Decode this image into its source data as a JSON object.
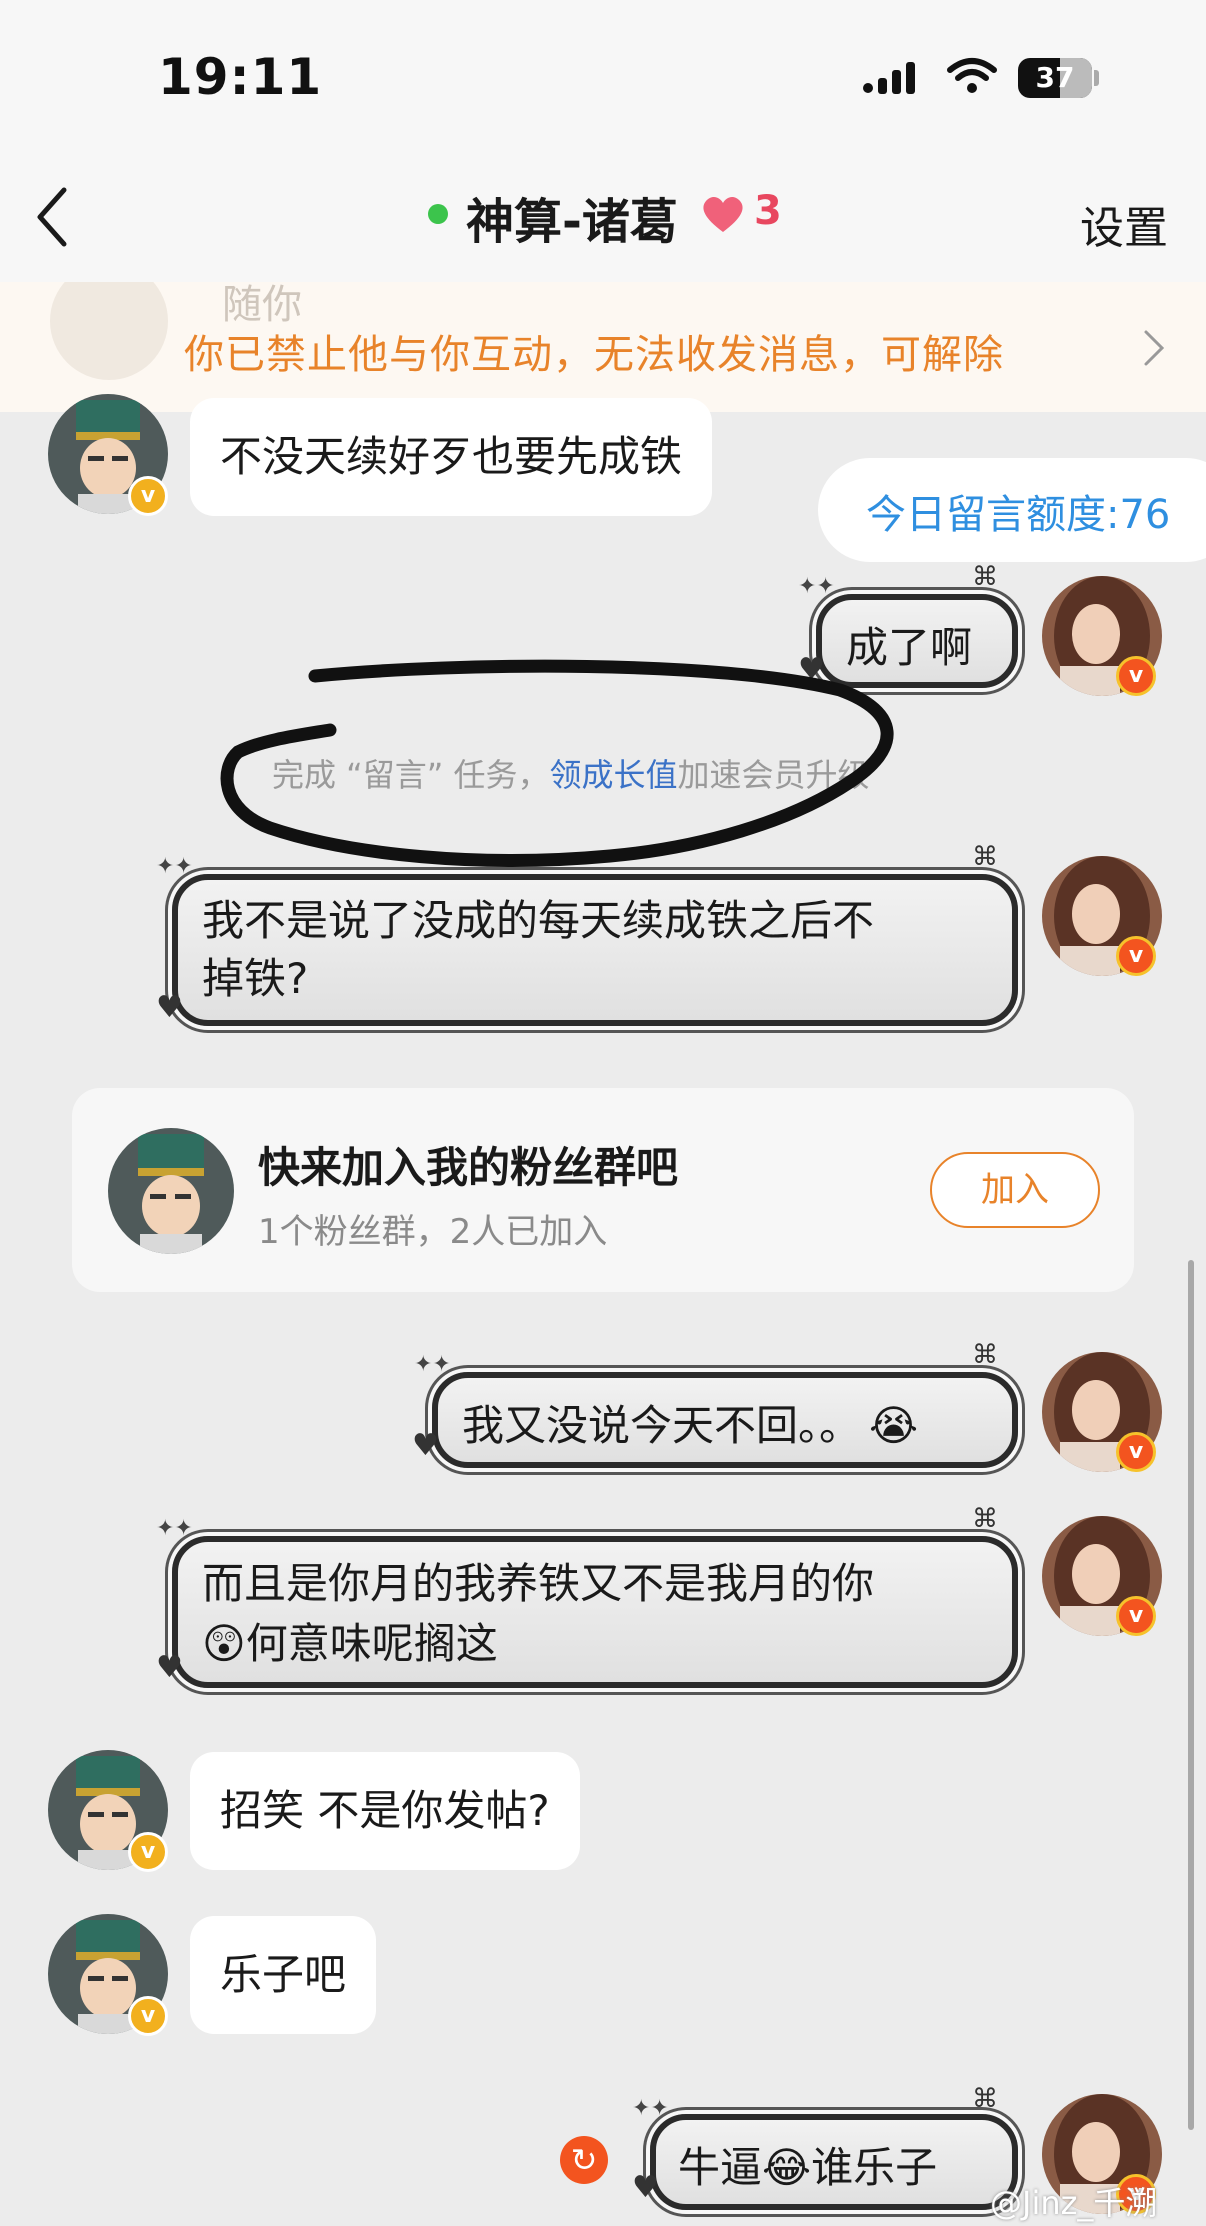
{
  "status_bar": {
    "time": "19:11",
    "battery": "37"
  },
  "nav": {
    "title": "神算-诸葛",
    "heart_count": "3",
    "settings_label": "设置",
    "icons": [
      "back-chevron-icon",
      "heart-icon"
    ]
  },
  "notice": {
    "text": "你已禁止他与你互动，无法收发消息，可解除",
    "ghost_name": "随你"
  },
  "quota": {
    "text": "今日留言额度:76"
  },
  "system_tip": {
    "prefix": "完成 “留言” 任务，",
    "link": "领成长值",
    "suffix": "加速会员升级"
  },
  "messages": [
    {
      "side": "left",
      "text": "不没天续好歹也要先成铁"
    },
    {
      "side": "right",
      "text": "成了啊"
    },
    {
      "side": "right",
      "line1": "我不是说了没成的每天续成铁之后不",
      "line2": "掉铁?"
    },
    {
      "side": "right",
      "text": "我又没说今天不回。。",
      "emoji": "😭"
    },
    {
      "side": "right",
      "line1": "而且是你月的我养铁又不是我月的你",
      "emoji": "😲",
      "line2": "何意味呢搁这"
    },
    {
      "side": "left",
      "text": "招笑 不是你发帖?"
    },
    {
      "side": "left",
      "text": "乐子吧"
    },
    {
      "side": "right",
      "text_a": "牛逼",
      "emoji": "😂",
      "text_b": "谁乐子"
    }
  ],
  "fan_group": {
    "title": "快来加入我的粉丝群吧",
    "subtitle": "1个粉丝群，2人已加入",
    "join_label": "加入"
  },
  "watermark": "@Jinz_千溯",
  "colors": {
    "accent_orange": "#e8832a",
    "link_blue": "#3b72c7",
    "quota_blue": "#2f8fe0",
    "heart_red": "#e8475f"
  }
}
